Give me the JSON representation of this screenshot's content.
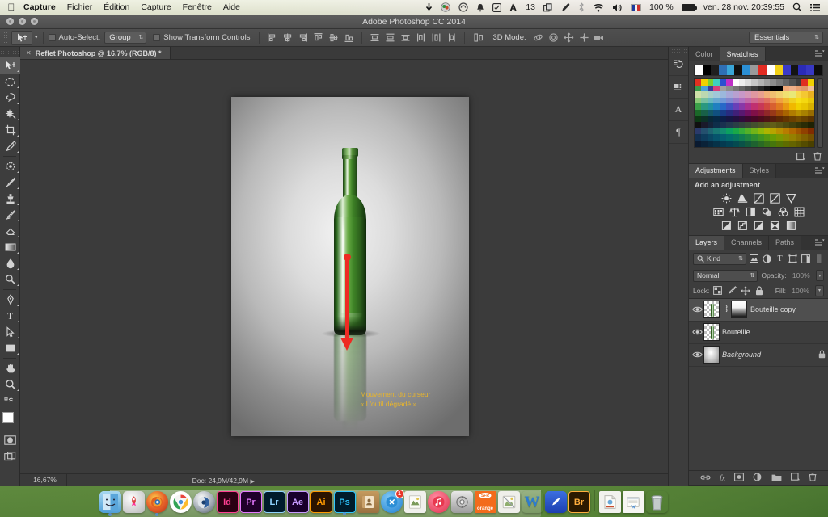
{
  "menubar": {
    "apple_icon": "apple-logo",
    "items": [
      {
        "label": "Capture",
        "bold": true
      },
      {
        "label": "Fichier",
        "bold": false
      },
      {
        "label": "Édition",
        "bold": false
      },
      {
        "label": "Capture",
        "bold": false
      },
      {
        "label": "Fenêtre",
        "bold": false
      },
      {
        "label": "Aide",
        "bold": false
      }
    ],
    "status_icons": [
      {
        "name": "arrow-down-icon",
        "glyph": "➘"
      },
      {
        "name": "dropbox-icon",
        "glyph": "◍"
      },
      {
        "name": "creativecloud-icon",
        "glyph": "◉"
      },
      {
        "name": "bell-icon",
        "glyph": "🔔"
      },
      {
        "name": "checkbox-app-icon",
        "glyph": "☑"
      },
      {
        "name": "adobe-app-icon",
        "glyph": "A"
      }
    ],
    "adobe_count": "13",
    "extra_icons": [
      {
        "name": "copy-icon",
        "glyph": "⧉"
      },
      {
        "name": "eyedropper-icon",
        "glyph": "✒"
      },
      {
        "name": "bluetooth-icon",
        "glyph": "ᛒ"
      },
      {
        "name": "wifi-icon",
        "glyph": "wifi"
      },
      {
        "name": "volume-icon",
        "glyph": "🔊"
      }
    ],
    "input_flag": "french-flag",
    "battery_percent": "100 %",
    "datetime": "ven. 28 nov.  20:39:55",
    "search_icon": "search-icon",
    "notification_icon": "notification-center-icon"
  },
  "window": {
    "title": "Adobe Photoshop CC 2014",
    "traffic_lights": [
      "close",
      "minimize",
      "zoom"
    ]
  },
  "options_bar": {
    "tool_icon": "move-tool-icon",
    "auto_select_label": "Auto-Select:",
    "auto_select_value": "Group",
    "show_transform_label": "Show Transform Controls",
    "align_group_1": [
      "align-left-edges",
      "align-horizontal-centers",
      "align-right-edges"
    ],
    "align_group_2": [
      "align-top-edges",
      "align-vertical-centers",
      "align-bottom-edges"
    ],
    "distribute_group_1": [
      "distribute-top-edges",
      "distribute-vertical-centers",
      "distribute-bottom-edges"
    ],
    "distribute_group_2": [
      "distribute-left-edges",
      "distribute-horizontal-centers",
      "distribute-right-edges"
    ],
    "auto_align_icon": "auto-align-layers-icon",
    "mode_3d_label": "3D Mode:",
    "mode_3d_icons": [
      "orbit-3d-icon",
      "roll-3d-icon",
      "pan-3d-icon",
      "slide-3d-icon",
      "camera-3d-icon"
    ],
    "workspace": "Essentials"
  },
  "toolbar": {
    "tools": [
      {
        "name": "move-tool",
        "glyph": "move",
        "active": true
      },
      {
        "name": "marquee-tool",
        "glyph": "ellipse"
      },
      {
        "name": "lasso-tool",
        "glyph": "lasso"
      },
      {
        "name": "quick-selection-tool",
        "glyph": "wand"
      },
      {
        "name": "crop-tool",
        "glyph": "crop"
      },
      {
        "name": "eyedropper-tool",
        "glyph": "dropper"
      },
      {
        "name": "spot-healing-tool",
        "glyph": "heal"
      },
      {
        "name": "brush-tool",
        "glyph": "brush"
      },
      {
        "name": "clone-stamp-tool",
        "glyph": "stamp"
      },
      {
        "name": "history-brush-tool",
        "glyph": "historybrush"
      },
      {
        "name": "eraser-tool",
        "glyph": "eraser"
      },
      {
        "name": "gradient-tool",
        "glyph": "gradient"
      },
      {
        "name": "blur-tool",
        "glyph": "blur"
      },
      {
        "name": "dodge-tool",
        "glyph": "dodge"
      },
      {
        "name": "pen-tool",
        "glyph": "pen"
      },
      {
        "name": "type-tool",
        "glyph": "T"
      },
      {
        "name": "path-selection-tool",
        "glyph": "arrowpath"
      },
      {
        "name": "shape-tool",
        "glyph": "rect"
      },
      {
        "name": "hand-tool",
        "glyph": "hand"
      },
      {
        "name": "zoom-tool",
        "glyph": "zoom"
      }
    ],
    "foreground_color": "#ffffff",
    "background_color": "#000000",
    "quick_mask_icon": "quick-mask-icon",
    "screen_mode_icon": "screen-mode-icon"
  },
  "document": {
    "tab_label": "Reflet Photoshop @ 16,7% (RGB/8) *",
    "close_icon": "close-icon",
    "zoom_level": "16,67%",
    "doc_info": "Doc: 24,9M/42,9M",
    "status_arrow": "▶"
  },
  "canvas": {
    "annotation_line1": "Mouvement du curseur",
    "annotation_line2": "« L'outil dégradé »",
    "annotation_color": "#e8b52c",
    "arrow_color": "#ee2a23",
    "subject": "green-wine-bottle-with-reflection"
  },
  "dock_strip": {
    "items": [
      {
        "name": "history-panel-icon",
        "glyph": "history"
      },
      {
        "name": "properties-panel-icon",
        "glyph": "properties"
      },
      {
        "name": "character-panel-icon",
        "glyph": "A"
      },
      {
        "name": "paragraph-panel-icon",
        "glyph": "¶"
      }
    ]
  },
  "color_panel": {
    "tabs": [
      {
        "label": "Color",
        "active": false
      },
      {
        "label": "Swatches",
        "active": true
      }
    ],
    "menu_icon": "panel-menu-icon",
    "recent_swatches": [
      "#ffffff",
      "#000000",
      "#1f1f1f",
      "#2f6fb5",
      "#3aa6d8",
      "#111111",
      "#2b8fd4",
      "#9a9a9a",
      "#e22b22",
      "#ffffff",
      "#f2d117",
      "#3b3bc8",
      "#141414",
      "#2b2bb8",
      "#3838c4",
      "#0d0d0d"
    ],
    "new_swatch_icon": "new-swatch-icon",
    "delete_swatch_icon": "trash-icon"
  },
  "adjustments_panel": {
    "tabs": [
      {
        "label": "Adjustments",
        "active": true
      },
      {
        "label": "Styles",
        "active": false
      }
    ],
    "menu_icon": "panel-menu-icon",
    "heading": "Add an adjustment",
    "row1": [
      "brightness-contrast-icon",
      "levels-icon",
      "curves-icon",
      "exposure-icon",
      "vibrance-icon"
    ],
    "row2": [
      "hue-saturation-icon",
      "color-balance-icon",
      "black-white-icon",
      "photo-filter-icon",
      "channel-mixer-icon",
      "color-lookup-icon"
    ],
    "row3": [
      "invert-icon",
      "posterize-icon",
      "threshold-icon",
      "selective-color-icon",
      "gradient-map-icon"
    ]
  },
  "layers_panel": {
    "tabs": [
      {
        "label": "Layers",
        "active": true
      },
      {
        "label": "Channels",
        "active": false
      },
      {
        "label": "Paths",
        "active": false
      }
    ],
    "menu_icon": "panel-menu-icon",
    "filter_label": "Kind",
    "filter_icons": [
      "filter-pixel-icon",
      "filter-adjustment-icon",
      "filter-type-icon",
      "filter-shape-icon",
      "filter-smart-icon"
    ],
    "filter_toggle_icon": "filter-toggle-icon",
    "blend_mode": "Normal",
    "opacity_label": "Opacity:",
    "opacity_value": "100%",
    "lock_label": "Lock:",
    "lock_icons": [
      "lock-transparent-pixels-icon",
      "lock-image-pixels-icon",
      "lock-position-icon",
      "lock-all-icon"
    ],
    "fill_label": "Fill:",
    "fill_value": "100%",
    "layers": [
      {
        "name": "Bouteille copy",
        "visible": true,
        "selected": true,
        "has_mask": true,
        "linked": true,
        "locked": false,
        "italic": false
      },
      {
        "name": "Bouteille",
        "visible": true,
        "selected": false,
        "has_mask": false,
        "linked": false,
        "locked": false,
        "italic": false
      },
      {
        "name": "Background",
        "visible": true,
        "selected": false,
        "has_mask": false,
        "linked": false,
        "locked": true,
        "italic": true
      }
    ],
    "footer_icons": [
      {
        "name": "link-layers-icon",
        "glyph": "∞"
      },
      {
        "name": "layer-style-fx-icon",
        "glyph": "fx"
      },
      {
        "name": "add-layer-mask-icon",
        "glyph": "▣"
      },
      {
        "name": "new-adjustment-layer-icon",
        "glyph": "◐"
      },
      {
        "name": "new-group-icon",
        "glyph": "▭"
      },
      {
        "name": "new-layer-icon",
        "glyph": "❏"
      },
      {
        "name": "delete-layer-icon",
        "glyph": "🗑"
      }
    ]
  },
  "dock": {
    "items": [
      {
        "name": "finder",
        "label": "",
        "type": "finder",
        "running": true
      },
      {
        "name": "launchpad",
        "label": "",
        "type": "launchpad",
        "running": false
      },
      {
        "name": "firefox",
        "label": "",
        "type": "firefox",
        "running": true
      },
      {
        "name": "chrome",
        "label": "",
        "type": "chrome",
        "running": false
      },
      {
        "name": "cinema4d",
        "label": "",
        "type": "cinema4d",
        "running": false
      },
      {
        "name": "indesign",
        "label": "Id",
        "type": "adobe",
        "color": "#ff3f92",
        "bg": "#2b0013",
        "running": false
      },
      {
        "name": "premiere",
        "label": "Pr",
        "type": "adobe",
        "color": "#e579ff",
        "bg": "#20002b",
        "running": false
      },
      {
        "name": "lightroom",
        "label": "Lr",
        "type": "adobe",
        "color": "#8fd4ff",
        "bg": "#001b2b",
        "running": false
      },
      {
        "name": "aftereffects",
        "label": "Ae",
        "type": "adobe",
        "color": "#c79aff",
        "bg": "#19002b",
        "running": false
      },
      {
        "name": "illustrator",
        "label": "Ai",
        "type": "adobe",
        "color": "#ff9a00",
        "bg": "#2b1400",
        "running": false
      },
      {
        "name": "photoshop",
        "label": "Ps",
        "type": "adobe",
        "color": "#2fc6ff",
        "bg": "#001c2b",
        "running": true
      },
      {
        "name": "contacts",
        "label": "",
        "type": "contacts",
        "running": false
      },
      {
        "name": "appstore",
        "label": "",
        "type": "appstore",
        "badge": "1",
        "running": false
      },
      {
        "name": "preview",
        "label": "",
        "type": "preview",
        "running": false
      },
      {
        "name": "itunes",
        "label": "",
        "type": "itunes",
        "running": false
      },
      {
        "name": "system-preferences",
        "label": "",
        "type": "sysprefs",
        "running": false
      },
      {
        "name": "orange",
        "label": "orange",
        "type": "orange",
        "running": false
      },
      {
        "name": "image-capture",
        "label": "",
        "type": "imagecapture",
        "running": false
      },
      {
        "name": "word",
        "label": "W",
        "type": "word",
        "running": false
      },
      {
        "name": "blue-app",
        "label": "",
        "type": "blueapp",
        "running": false
      },
      {
        "name": "bridge",
        "label": "Br",
        "type": "adobe",
        "color": "#ffae3d",
        "bg": "#2b1a00",
        "running": false
      },
      {
        "name": "pdf-document",
        "label": "",
        "type": "pdfdoc",
        "running": false
      },
      {
        "name": "word-document",
        "label": "",
        "type": "worddoc",
        "running": false
      },
      {
        "name": "trash",
        "label": "",
        "type": "trash",
        "running": false
      }
    ]
  }
}
